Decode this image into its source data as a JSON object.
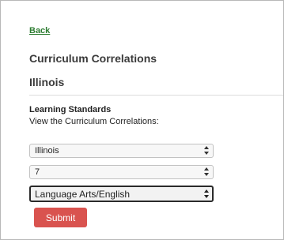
{
  "nav": {
    "back_label": "Back"
  },
  "header": {
    "title": "Curriculum Correlations",
    "state": "Illinois"
  },
  "form": {
    "section_label": "Learning Standards",
    "section_subtitle": "View the Curriculum Correlations:",
    "state_select": {
      "value": "Illinois",
      "icon": "updown-arrows-icon"
    },
    "grade_select": {
      "value": "7",
      "icon": "updown-arrows-icon"
    },
    "subject_select": {
      "value": "Language Arts/English",
      "icon": "updown-arrows-icon"
    },
    "submit_label": "Submit"
  },
  "colors": {
    "link": "#2e7d32",
    "submit_bg": "#d9534f",
    "submit_text": "#ffffff",
    "heading": "#3a3a3a"
  }
}
